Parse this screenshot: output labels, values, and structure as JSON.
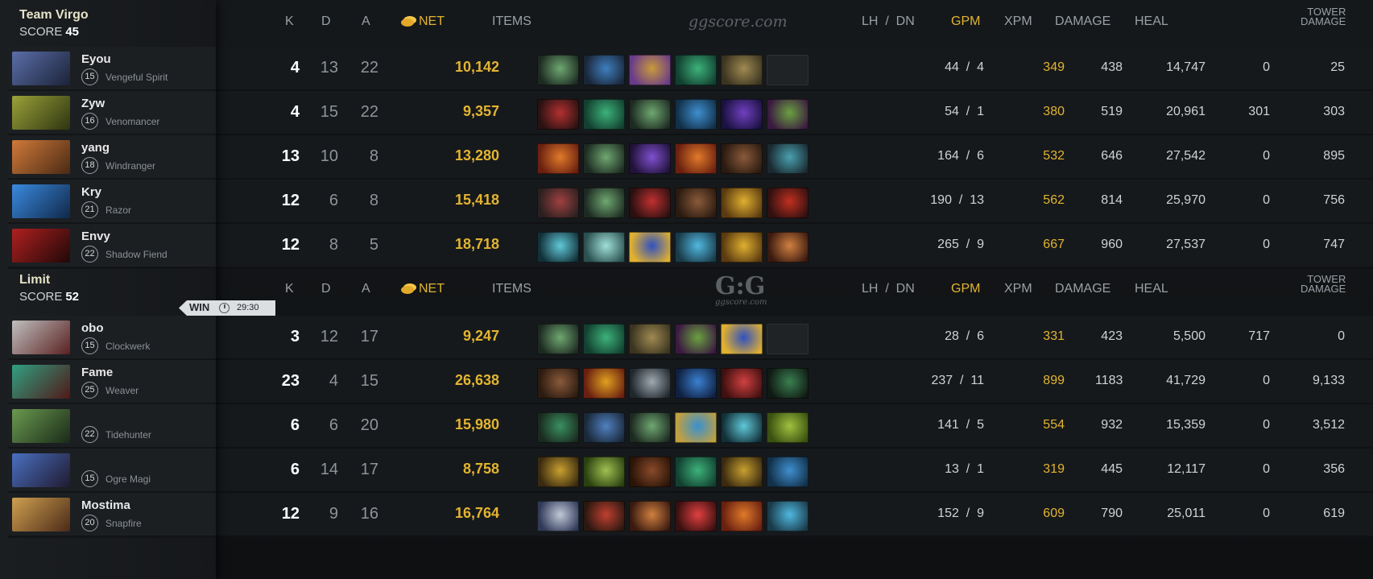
{
  "colors": {
    "gold": "#e2b431",
    "bg": "#15181b"
  },
  "teams": [
    {
      "name": "Team Virgo",
      "score_label": "SCORE",
      "score": "45",
      "logo": "ggscore.com",
      "columns": {
        "k": "K",
        "d": "D",
        "a": "A",
        "net": "NET",
        "items": "ITEMS",
        "lh_dn": "LH  /  DN",
        "gpm": "GPM",
        "xpm": "XPM",
        "damage": "DAMAGE",
        "heal": "HEAL",
        "tower1": "TOWER",
        "tower2": "DAMAGE"
      },
      "players": [
        {
          "name": "Eyou",
          "level": "15",
          "hero": "Vengeful Spirit",
          "k": "4",
          "d": "13",
          "a": "22",
          "net": "10,142",
          "lh_dn": "44  /  4",
          "gpm": "349",
          "xpm": "438",
          "damage": "14,747",
          "heal": "0",
          "tower": "25",
          "portrait": [
            "#5a6ea8",
            "#1c2338"
          ],
          "items": [
            [
              "#6fa870",
              "#1d2a22"
            ],
            [
              "#3f7fc0",
              "#1a2638"
            ],
            [
              "#c89a3a",
              "#6a3b8a"
            ],
            [
              "#3db27a",
              "#124030"
            ],
            [
              "#a08a52",
              "#3a3420"
            ],
            null
          ]
        },
        {
          "name": "Zyw",
          "level": "16",
          "hero": "Venomancer",
          "k": "4",
          "d": "15",
          "a": "22",
          "net": "9,357",
          "lh_dn": "54  /  1",
          "gpm": "380",
          "xpm": "519",
          "damage": "20,961",
          "heal": "301",
          "tower": "303",
          "portrait": [
            "#9aa23a",
            "#2e3410"
          ],
          "items": [
            [
              "#b43030",
              "#2a1212"
            ],
            [
              "#3db27a",
              "#124030"
            ],
            [
              "#6fa870",
              "#1d2a22"
            ],
            [
              "#3f8fd0",
              "#123048"
            ],
            [
              "#7040c0",
              "#1a1240"
            ],
            [
              "#6aa040",
              "#3a1a40"
            ]
          ]
        },
        {
          "name": "yang",
          "level": "18",
          "hero": "Windranger",
          "k": "13",
          "d": "10",
          "a": "8",
          "net": "13,280",
          "lh_dn": "164  /  6",
          "gpm": "532",
          "xpm": "646",
          "damage": "27,542",
          "heal": "0",
          "tower": "895",
          "portrait": [
            "#d07a3a",
            "#4a2a14"
          ],
          "items": [
            [
              "#e07a2a",
              "#6a2010"
            ],
            [
              "#6fa870",
              "#1d2a22"
            ],
            [
              "#8050d0",
              "#201238"
            ],
            [
              "#e07a2a",
              "#6a2010"
            ],
            [
              "#8a5a3a",
              "#2a1a10"
            ],
            [
              "#4aa0b0",
              "#1a2a30"
            ]
          ]
        },
        {
          "name": "Kry",
          "level": "21",
          "hero": "Razor",
          "k": "12",
          "d": "6",
          "a": "8",
          "net": "15,418",
          "lh_dn": "190  /  13",
          "gpm": "562",
          "xpm": "814",
          "damage": "25,970",
          "heal": "0",
          "tower": "756",
          "portrait": [
            "#3a8ae0",
            "#102848"
          ],
          "items": [
            [
              "#a04040",
              "#2a2020"
            ],
            [
              "#6fa870",
              "#1d2a22"
            ],
            [
              "#c03030",
              "#2a1010"
            ],
            [
              "#8a5a3a",
              "#2a1a10"
            ],
            [
              "#e0b030",
              "#5a3a10"
            ],
            [
              "#c03020",
              "#301010"
            ]
          ]
        },
        {
          "name": "Envy",
          "level": "22",
          "hero": "Shadow Fiend",
          "k": "12",
          "d": "8",
          "a": "5",
          "net": "18,718",
          "lh_dn": "265  /  9",
          "gpm": "667",
          "xpm": "960",
          "damage": "27,537",
          "heal": "0",
          "tower": "747",
          "portrait": [
            "#b02020",
            "#200808"
          ],
          "items": [
            [
              "#60c8d8",
              "#123038"
            ],
            [
              "#a0e0d8",
              "#2a5050"
            ],
            [
              "#3050c0",
              "#e0b030"
            ],
            [
              "#50b8e0",
              "#1a3a48"
            ],
            [
              "#e0b030",
              "#5a3a10"
            ],
            [
              "#d08040",
              "#3a1a10"
            ]
          ]
        }
      ]
    },
    {
      "name": "Limit",
      "score_label": "SCORE",
      "score": "52",
      "logo": "G:G",
      "logo_sub": "ggscore.com",
      "columns": {
        "k": "K",
        "d": "D",
        "a": "A",
        "net": "NET",
        "items": "ITEMS",
        "lh_dn": "LH  /  DN",
        "gpm": "GPM",
        "xpm": "XPM",
        "damage": "DAMAGE",
        "heal": "HEAL",
        "tower1": "TOWER",
        "tower2": "DAMAGE"
      },
      "result": {
        "label": "WIN",
        "time": "29:30"
      },
      "players": [
        {
          "name": "obo",
          "level": "15",
          "hero": "Clockwerk",
          "k": "3",
          "d": "12",
          "a": "17",
          "net": "9,247",
          "lh_dn": "28  /  6",
          "gpm": "331",
          "xpm": "423",
          "damage": "5,500",
          "heal": "717",
          "tower": "0",
          "portrait": [
            "#c0c0c0",
            "#5a2020"
          ],
          "items": [
            [
              "#6fa870",
              "#1d2a22"
            ],
            [
              "#3db27a",
              "#124030"
            ],
            [
              "#a08a52",
              "#3a3420"
            ],
            [
              "#6aa040",
              "#3a1a40"
            ],
            [
              "#3050c0",
              "#e0b030"
            ],
            null
          ]
        },
        {
          "name": "Fame",
          "level": "25",
          "hero": "Weaver",
          "k": "23",
          "d": "4",
          "a": "15",
          "net": "26,638",
          "lh_dn": "237  /  11",
          "gpm": "899",
          "xpm": "1183",
          "damage": "41,729",
          "heal": "0",
          "tower": "9,133",
          "portrait": [
            "#30a080",
            "#501818"
          ],
          "items": [
            [
              "#8a5a3a",
              "#2a1a10"
            ],
            [
              "#e0a020",
              "#6a2010"
            ],
            [
              "#a0a8b0",
              "#20282e"
            ],
            [
              "#3a80d0",
              "#102040"
            ],
            [
              "#d04040",
              "#401010"
            ],
            [
              "#3a8050",
              "#101a14"
            ]
          ]
        },
        {
          "name": "",
          "level": "22",
          "hero": "Tidehunter",
          "k": "6",
          "d": "6",
          "a": "20",
          "net": "15,980",
          "lh_dn": "141  /  5",
          "gpm": "554",
          "xpm": "932",
          "damage": "15,359",
          "heal": "0",
          "tower": "3,512",
          "portrait": [
            "#6a9a50",
            "#1a2a18"
          ],
          "items": [
            [
              "#3a9060",
              "#1a2a20"
            ],
            [
              "#5080c0",
              "#1a2838"
            ],
            [
              "#6fa870",
              "#1d2a22"
            ],
            [
              "#3a90d0",
              "#c0a040"
            ],
            [
              "#60c8d8",
              "#123038"
            ],
            [
              "#a0c040",
              "#3a5010"
            ]
          ]
        },
        {
          "name": "",
          "level": "15",
          "hero": "Ogre Magi",
          "k": "6",
          "d": "14",
          "a": "17",
          "net": "8,758",
          "lh_dn": "13  /  1",
          "gpm": "319",
          "xpm": "445",
          "damage": "12,117",
          "heal": "0",
          "tower": "356",
          "portrait": [
            "#4a70c0",
            "#201a30"
          ],
          "items": [
            [
              "#c8a030",
              "#3a2a10"
            ],
            [
              "#a0c050",
              "#2a4010"
            ],
            [
              "#8a4a2a",
              "#2a1408"
            ],
            [
              "#3db27a",
              "#124030"
            ],
            [
              "#c8a030",
              "#3a2a10"
            ],
            [
              "#3f8fd0",
              "#123048"
            ]
          ]
        },
        {
          "name": "Mostima",
          "level": "20",
          "hero": "Snapfire",
          "k": "12",
          "d": "9",
          "a": "16",
          "net": "16,764",
          "lh_dn": "152  /  9",
          "gpm": "609",
          "xpm": "790",
          "damage": "25,011",
          "heal": "0",
          "tower": "619",
          "portrait": [
            "#d0a050",
            "#4a2a18"
          ],
          "items": [
            [
              "#c0c8d8",
              "#303a58"
            ],
            [
              "#c04030",
              "#2a1810"
            ],
            [
              "#d08040",
              "#3a1a10"
            ],
            [
              "#e04040",
              "#3a1010"
            ],
            [
              "#e07a2a",
              "#6a2010"
            ],
            [
              "#50b8e0",
              "#1a3a48"
            ]
          ]
        }
      ]
    }
  ]
}
